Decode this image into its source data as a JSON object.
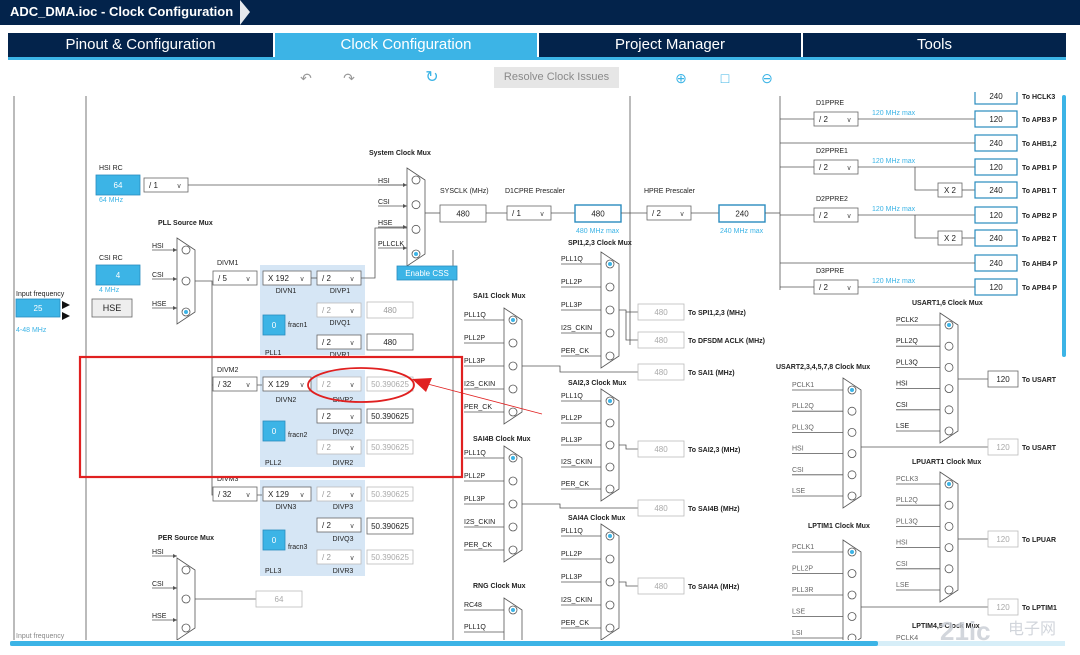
{
  "window": {
    "title": "ADC_DMA.ioc - Clock Configuration"
  },
  "tabs": [
    {
      "label": "Pinout & Configuration"
    },
    {
      "label": "Clock Configuration"
    },
    {
      "label": "Project Manager"
    },
    {
      "label": "Tools"
    }
  ],
  "toolbar": {
    "resolve_label": "Resolve Clock Issues"
  },
  "icons": [
    "undo-icon",
    "redo-icon",
    "refresh-icon",
    "zoom-in-icon",
    "fit-icon",
    "zoom-out-icon"
  ],
  "colors": {
    "accent": "#3cb4e6",
    "header": "#03234b",
    "highlight": "#e02020",
    "pll_bg": "#d6e6f5"
  },
  "diagram": {
    "hsi_rc": {
      "label": "HSI RC",
      "value": "64",
      "freq": "64 MHz",
      "div": "/ 1"
    },
    "csi_rc": {
      "label": "CSI RC",
      "value": "4",
      "freq": "4 MHz"
    },
    "input_freq": {
      "label": "Input frequency",
      "value": "25",
      "range": "4-48 MHz"
    },
    "input_freq_bottom": "Input frequency",
    "hse": "HSE",
    "pll_source_mux": {
      "title": "PLL Source Mux",
      "inputs": [
        "HSI",
        "CSI",
        "HSE"
      ]
    },
    "system_clock_mux": {
      "title": "System Clock Mux",
      "inputs": [
        "HSI",
        "CSI",
        "HSE",
        "PLLCLK"
      ]
    },
    "sysclk": {
      "label": "SYSCLK (MHz)",
      "value": "480"
    },
    "d1cpre": {
      "label": "D1CPRE Prescaler",
      "value": "/ 1",
      "out": "480",
      "max": "480 MHz max"
    },
    "hpre": {
      "label": "HPRE Prescaler",
      "value": "/ 2",
      "out": "240",
      "max": "240 MHz max"
    },
    "enable_css": "Enable CSS",
    "pll1": {
      "divm_label": "DIVM1",
      "divm": "/ 5",
      "mult": "X 192",
      "divn": "DIVN1",
      "divp": "/ 2",
      "divp_label": "DIVP1",
      "divq": "/ 2",
      "divq_label": "DIVQ1",
      "divq_out": "480",
      "divr": "/ 2",
      "divr_label": "DIVR1",
      "divr_out": "480",
      "fracn": "0",
      "fracn_label": "fracn1",
      "name": "PLL1"
    },
    "pll2": {
      "divm_label": "DIVM2",
      "divm": "/ 32",
      "mult": "X 129",
      "divn": "DIVN2",
      "divp": "/ 2",
      "divp_label": "DIVP2",
      "divp_out": "50.390625",
      "divq": "/ 2",
      "divq_label": "DIVQ2",
      "divq_out": "50.390625",
      "divr": "/ 2",
      "divr_label": "DIVR2",
      "divr_out": "50.390625",
      "fracn": "0",
      "fracn_label": "fracn2",
      "name": "PLL2"
    },
    "pll3": {
      "divm_label": "DIVM3",
      "divm": "/ 32",
      "mult": "X 129",
      "divn": "DIVN3",
      "divp": "/ 2",
      "divp_label": "DIVP3",
      "divp_out": "50.390625",
      "divq": "/ 2",
      "divq_label": "DIVQ3",
      "divq_out": "50.390625",
      "divr": "/ 2",
      "divr_label": "DIVR3",
      "divr_out": "50.390625",
      "fracn": "0",
      "fracn_label": "fracn3",
      "name": "PLL3"
    },
    "per_source_mux": {
      "title": "PER Source Mux",
      "inputs": [
        "HSI",
        "CSI",
        "HSE"
      ],
      "out": "64"
    },
    "spi123": {
      "title": "SPI1,2,3 Clock Mux",
      "inputs": [
        "PLL1Q",
        "PLL2P",
        "PLL3P",
        "I2S_CKIN",
        "PER_CK"
      ],
      "out": "480",
      "to": "To SPI1,2,3 (MHz)"
    },
    "dfsdm": {
      "out": "480",
      "to": "To DFSDM ACLK (MHz)"
    },
    "sai1": {
      "title": "SAI1 Clock Mux",
      "inputs": [
        "PLL1Q",
        "PLL2P",
        "PLL3P",
        "I2S_CKIN",
        "PER_CK"
      ],
      "out": "480",
      "to": "To SAI1 (MHz)"
    },
    "sai23": {
      "title": "SAI2,3 Clock Mux",
      "inputs": [
        "PLL1Q",
        "PLL2P",
        "PLL3P",
        "I2S_CKIN",
        "PER_CK"
      ],
      "out": "480",
      "to": "To SAI2,3 (MHz)"
    },
    "sai4b": {
      "title": "SAI4B Clock Mux",
      "inputs": [
        "PLL1Q",
        "PLL2P",
        "PLL3P",
        "I2S_CKIN",
        "PER_CK"
      ],
      "out": "480",
      "to": "To SAI4B (MHz)"
    },
    "sai4a": {
      "title": "SAI4A Clock Mux",
      "inputs": [
        "PLL1Q",
        "PLL2P",
        "PLL3P",
        "I2S_CKIN",
        "PER_CK"
      ],
      "out": "480",
      "to": "To SAI4A (MHz)"
    },
    "rng": {
      "title": "RNG Clock Mux",
      "inputs": [
        "RC48",
        "PLL1Q"
      ]
    },
    "apb": {
      "d1ppre": {
        "label": "D1PPRE",
        "value": "/ 2",
        "max": "120 MHz max"
      },
      "d2ppre1": {
        "label": "D2PPRE1",
        "value": "/ 2",
        "max": "120 MHz max"
      },
      "d2ppre2": {
        "label": "D2PPRE2",
        "value": "/ 2",
        "max": "120 MHz max"
      },
      "d3ppre": {
        "label": "D3PPRE",
        "value": "/ 2",
        "max": "120 MHz max"
      },
      "x2": "X 2",
      "outputs": [
        {
          "value": "240",
          "to": "To HCLK3"
        },
        {
          "value": "120",
          "to": "To APB3 P"
        },
        {
          "value": "240",
          "to": "To AHB1,2"
        },
        {
          "value": "120",
          "to": "To APB1 P"
        },
        {
          "value": "240",
          "to": "To APB1 T"
        },
        {
          "value": "120",
          "to": "To APB2 P"
        },
        {
          "value": "240",
          "to": "To APB2 T"
        },
        {
          "value": "240",
          "to": "To AHB4 P"
        },
        {
          "value": "120",
          "to": "To APB4 P"
        }
      ]
    },
    "usart16": {
      "title": "USART1,6 Clock Mux",
      "inputs": [
        "PCLK2",
        "PLL2Q",
        "PLL3Q",
        "HSI",
        "CSI",
        "LSE"
      ],
      "out": "120",
      "to": "To USART"
    },
    "usart2345": {
      "title": "USART2,3,4,5,7,8 Clock Mux",
      "inputs": [
        "PCLK1",
        "PLL2Q",
        "PLL3Q",
        "HSI",
        "CSI",
        "LSE"
      ],
      "out": "120",
      "to": "To USART"
    },
    "lpuart1": {
      "title": "LPUART1 Clock Mux",
      "inputs": [
        "PCLK3",
        "PLL2Q",
        "PLL3Q",
        "HSI",
        "CSI",
        "LSE"
      ],
      "out": "120",
      "to": "To LPUAR"
    },
    "lptim1": {
      "title": "LPTIM1 Clock Mux",
      "inputs": [
        "PCLK1",
        "PLL2P",
        "PLL3R",
        "LSE",
        "LSI"
      ],
      "out": "120",
      "to": "To LPTIM1"
    },
    "lptim45": {
      "title": "LPTIM4,5 Clock Mux",
      "inputs": [
        "PCLK4"
      ]
    }
  },
  "watermark": "电子网"
}
